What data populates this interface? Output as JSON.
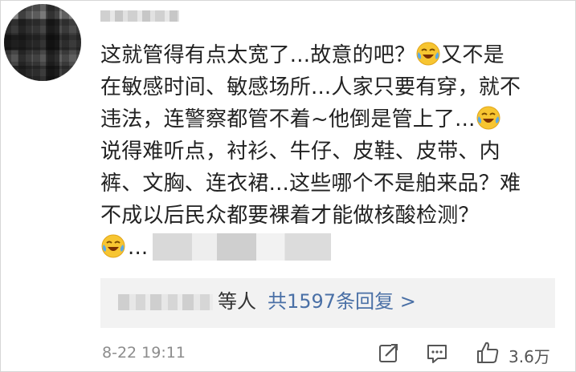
{
  "comment": {
    "lines": [
      "这就管得有点太宽了...故意的吧？",
      "又不是",
      "在敏感时间、敏感场所...人家只要有穿，就不",
      "违法，连警察都管不着~他倒是管上了...",
      "说得难听点，衬衫、牛仔、皮鞋、皮带、内",
      "裤、文胸、连衣裙...这些哪个不是舶来品？难",
      "不成以后民众都要裸着才能做核酸检测？"
    ],
    "last_line_tail": "..."
  },
  "icons": {
    "avatar": "blurred-avatar",
    "emoji": "laughing-crying-emoji",
    "share": "share-icon",
    "reply": "comment-icon",
    "like": "thumbs-up-icon"
  },
  "replies": {
    "suffix": "等人",
    "link": "共1597条回复 >"
  },
  "footer": {
    "timestamp": "8-22 19:11",
    "like_count": "3.6万"
  },
  "colors": {
    "link": "#4a70a6",
    "reply_bg": "#f2f2f2",
    "meta_text": "#8c8c8c"
  }
}
